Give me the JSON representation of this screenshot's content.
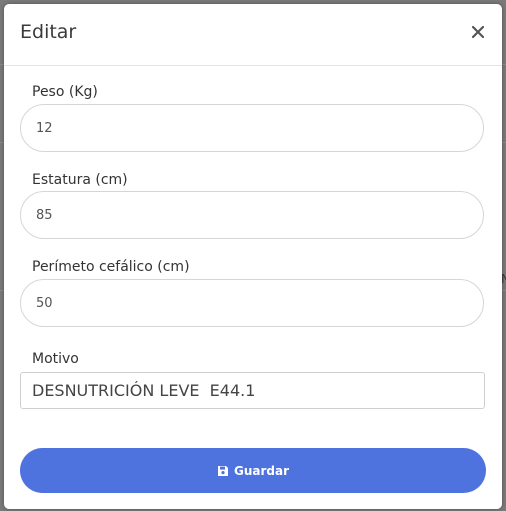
{
  "modal": {
    "title": "Editar",
    "close_icon": "close-icon"
  },
  "form": {
    "peso": {
      "label": "Peso (Kg)",
      "value": "12"
    },
    "estatura": {
      "label": "Estatura (cm)",
      "value": "85"
    },
    "perimetro": {
      "label": "Perímeto cefálico (cm)",
      "value": "50"
    },
    "motivo": {
      "label": "Motivo",
      "value": "DESNUTRICIÓN LEVE  E44.1"
    }
  },
  "actions": {
    "save_label": "Guardar",
    "save_icon": "floppy-disk-icon",
    "save_color": "#4e73df"
  },
  "background": {
    "edge_glyph_right": "N"
  }
}
